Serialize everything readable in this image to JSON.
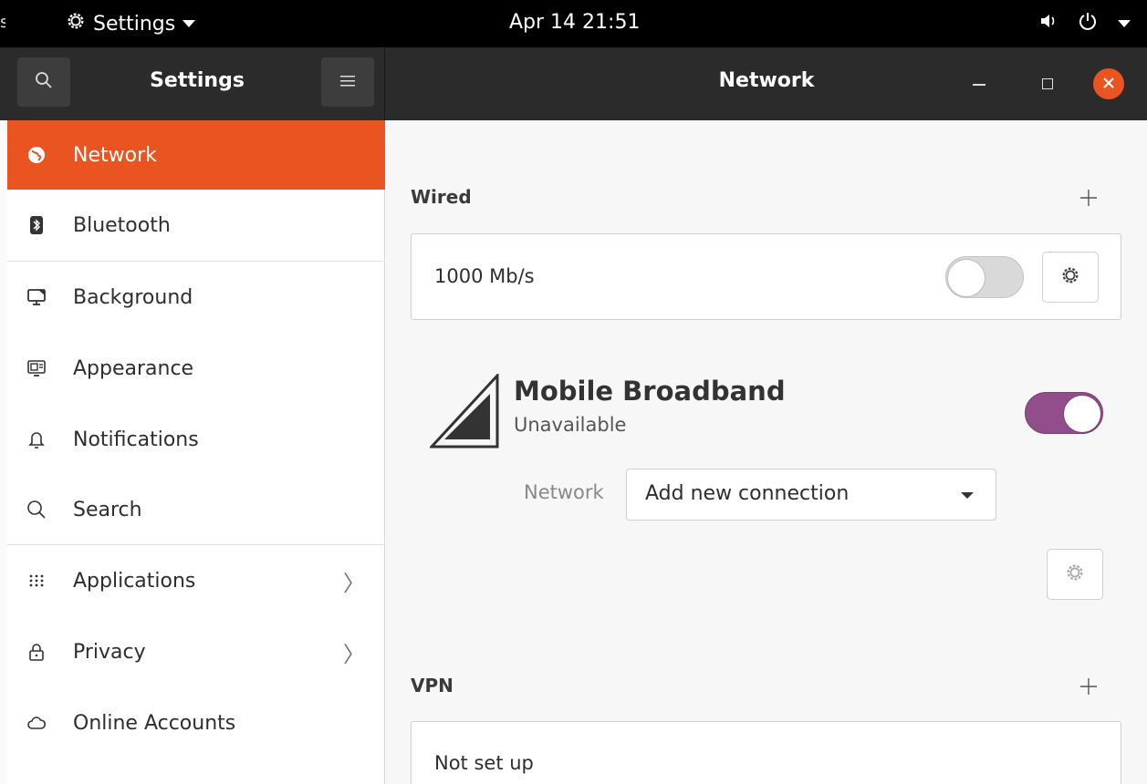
{
  "topbar": {
    "activities_fragment": "s",
    "app_menu_label": "Settings",
    "clock": "Apr 14  21:51"
  },
  "header": {
    "left_title": "Settings",
    "main_title": "Network"
  },
  "sidebar": {
    "items": [
      {
        "label": "Network",
        "icon": "network-globe-icon"
      },
      {
        "label": "Bluetooth",
        "icon": "bluetooth-icon"
      },
      {
        "label": "Background",
        "icon": "background-monitor-icon"
      },
      {
        "label": "Appearance",
        "icon": "appearance-icon"
      },
      {
        "label": "Notifications",
        "icon": "bell-icon"
      },
      {
        "label": "Search",
        "icon": "search-icon"
      },
      {
        "label": "Applications",
        "icon": "grid-icon",
        "chevron": "〉"
      },
      {
        "label": "Privacy",
        "icon": "lock-icon",
        "chevron": "〉"
      },
      {
        "label": "Online Accounts",
        "icon": "cloud-icon"
      }
    ]
  },
  "main": {
    "wired": {
      "title": "Wired",
      "connection_label": "1000 Mb/s",
      "enabled": false
    },
    "mobile": {
      "title": "Mobile Broadband",
      "status": "Unavailable",
      "enabled": true,
      "network_label": "Network",
      "network_value": "Add new connection"
    },
    "vpn": {
      "title": "VPN",
      "status": "Not set up"
    }
  },
  "colors": {
    "accent": "#e95420",
    "switch_on": "#924d8b",
    "headerbar": "#2b2b2b"
  }
}
